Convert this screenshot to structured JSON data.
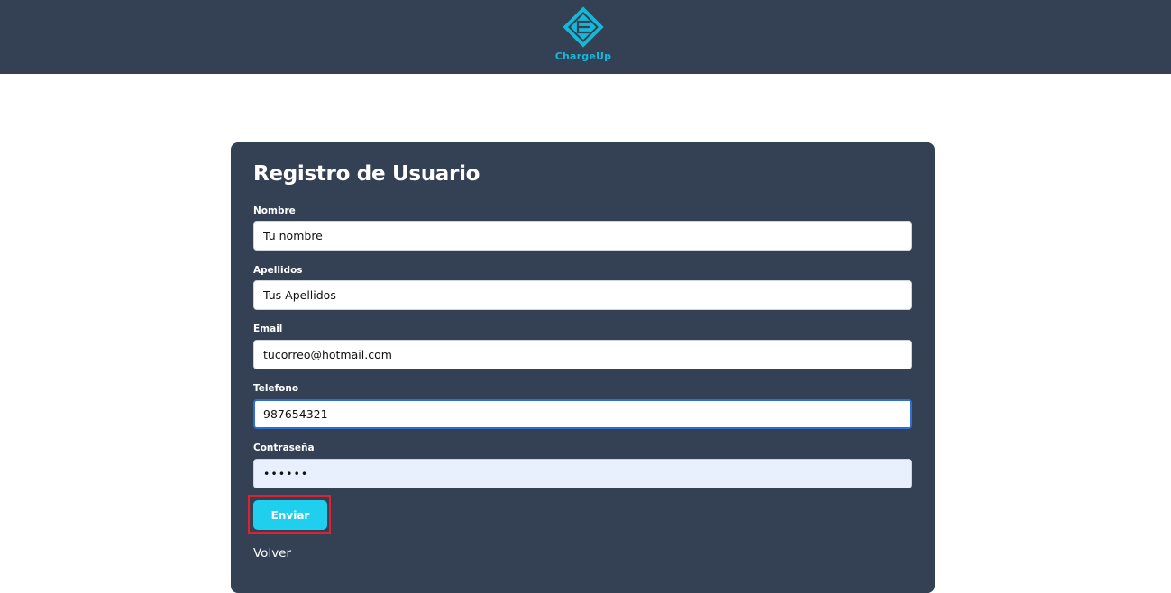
{
  "header": {
    "logo_text": "ChargeUp",
    "logo_icon": "chargeup-diamond-logo",
    "brand_color": "#16b8d8",
    "background_color": "#344054"
  },
  "form": {
    "title": "Registro de Usuario",
    "fields": [
      {
        "label": "Nombre",
        "value": "Tu nombre"
      },
      {
        "label": "Apellidos",
        "value": "Tus Apellidos"
      },
      {
        "label": "Email",
        "value": "tucorreo@hotmail.com"
      },
      {
        "label": "Telefono",
        "value": "987654321"
      },
      {
        "label": "Contraseña",
        "value": "••••••"
      }
    ],
    "submit_label": "Enviar",
    "submit_color": "#20cfee",
    "highlight_color": "#e0212f",
    "back_label": "Volver"
  }
}
